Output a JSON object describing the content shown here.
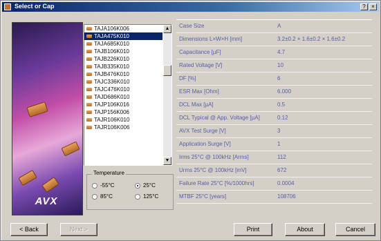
{
  "window": {
    "title": "Select or Cap"
  },
  "parts_list": {
    "items": [
      "TAJA106K006",
      "TAJA475K010",
      "TAJA685K010",
      "TAJB106K010",
      "TAJB226K010",
      "TAJB335K010",
      "TAJB476K010",
      "TAJC336K010",
      "TAJC476K010",
      "TAJD686K010",
      "TAJP106K016",
      "TAJP156K006",
      "TAJR106K010",
      "TAJR106K006"
    ],
    "selected_index": 1
  },
  "temperature": {
    "title": "Temperature",
    "options": [
      "-55°C",
      "25°C",
      "85°C",
      "125°C"
    ],
    "selected": "25°C"
  },
  "properties": [
    {
      "label": "Case Size",
      "value": "A"
    },
    {
      "label": "Dimensions L×W×H [mm]",
      "value": "3.2±0.2 × 1.6±0.2 × 1.6±0.2"
    },
    {
      "label": "Capacitance [µF]",
      "value": "4.7"
    },
    {
      "label": "Rated Voltage [V]",
      "value": "10"
    },
    {
      "label": "DF [%]",
      "value": "6"
    },
    {
      "label": "ESR Max [Ohm]",
      "value": "6.000"
    },
    {
      "label": "DCL Max [µA]",
      "value": "0.5"
    },
    {
      "label": "DCL Typical @ App. Voltage [µA]",
      "value": "0.12"
    },
    {
      "label": "AVX Test Surge [V]",
      "value": "3"
    },
    {
      "label": "Application Surge [V]",
      "value": "1"
    },
    {
      "label": "Irms 25°C @ 100kHz [Arms]",
      "value": "112"
    },
    {
      "label": "Urms 25°C @ 100kHz [mV]",
      "value": "672"
    },
    {
      "label": "Failure Rate 25°C [%/1000hrs]",
      "value": "0.0004"
    },
    {
      "label": "MTBF 25°C [years]",
      "value": "108706"
    }
  ],
  "buttons": {
    "back": "< Back",
    "next": "Next >",
    "print": "Print",
    "about": "About",
    "cancel": "Cancel"
  },
  "brand": {
    "logo_text": "AVX"
  },
  "titlebar_buttons": {
    "help": "?",
    "close": "×"
  }
}
